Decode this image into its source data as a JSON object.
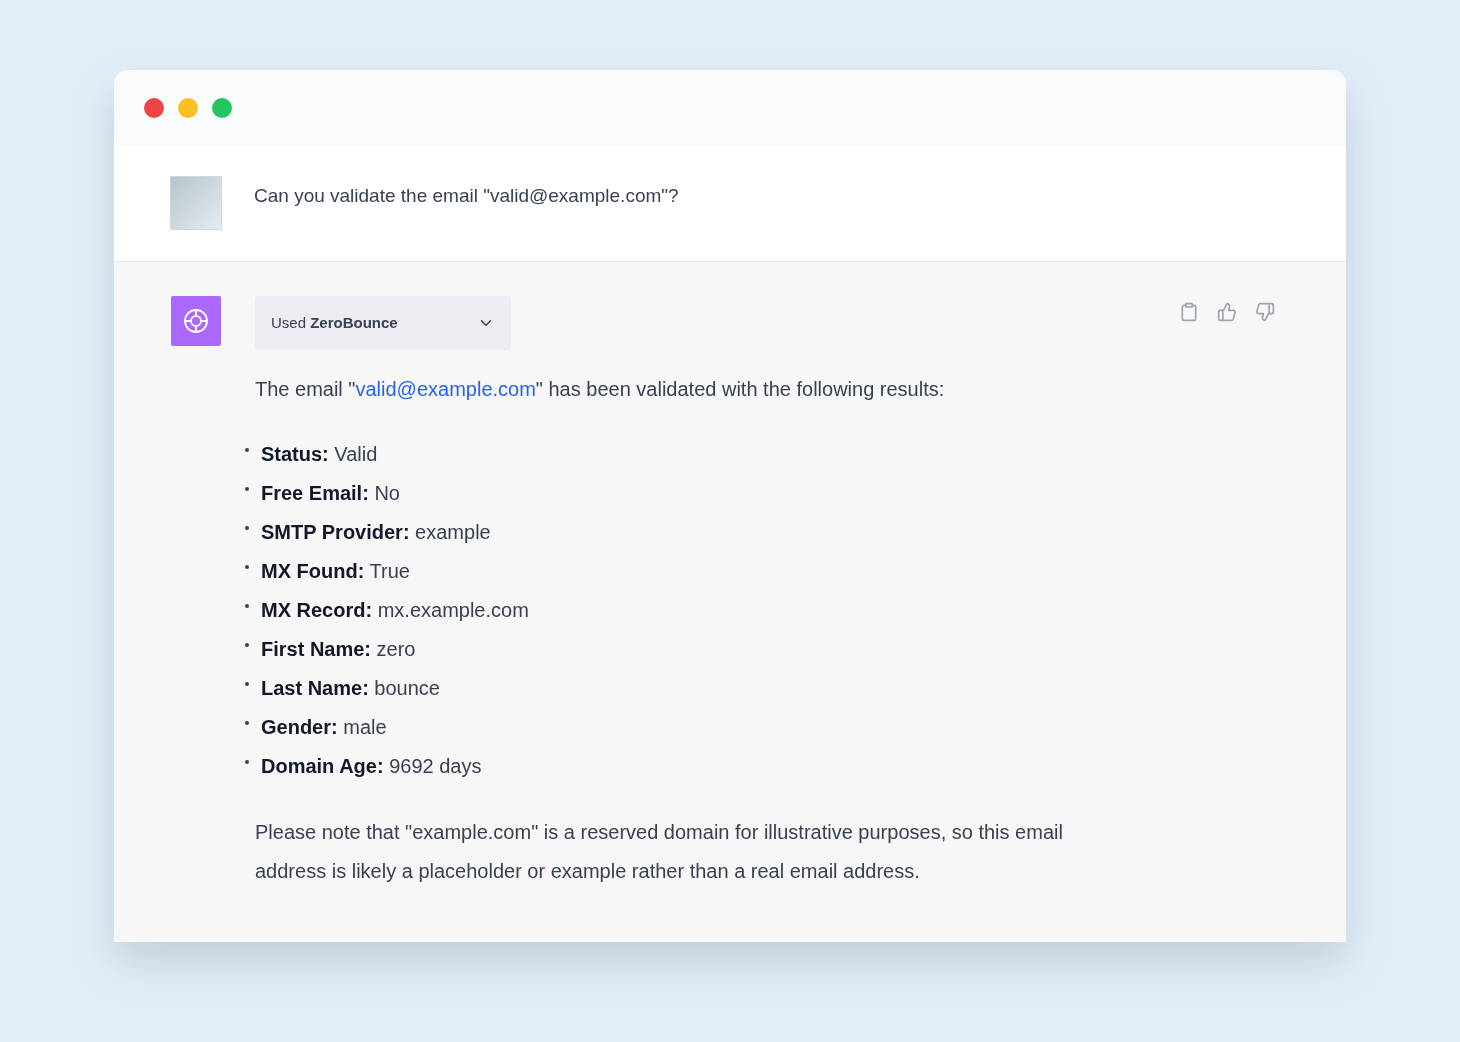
{
  "window": {
    "controls": [
      {
        "color": "#ef4444"
      },
      {
        "color": "#fbbf24"
      },
      {
        "color": "#22c55e"
      }
    ]
  },
  "user_message": {
    "text": "Can you validate the email \"valid@example.com\"?"
  },
  "assistant_message": {
    "plugin": {
      "label": "Used **ZeroBounce**"
    },
    "intro": {
      "before": "The email \"",
      "link": "valid@example.com",
      "after": "\" has been validated with the following results:"
    },
    "results": [
      {
        "text": "**Status:** Valid"
      },
      {
        "text": "**Free Email:** No"
      },
      {
        "text": "**SMTP Provider:** example"
      },
      {
        "text": "**MX Found:** True"
      },
      {
        "text": "**MX Record:** mx.example.com"
      },
      {
        "text": "**First Name:** zero"
      },
      {
        "text": "**Last Name:** bounce"
      },
      {
        "text": "**Gender:** male"
      },
      {
        "text": "**Domain Age:** 9692 days"
      }
    ],
    "note": "Please note that \"example.com\" is a reserved domain for illustrative purposes, so this email address is likely a placeholder or example rather than a real email address."
  }
}
